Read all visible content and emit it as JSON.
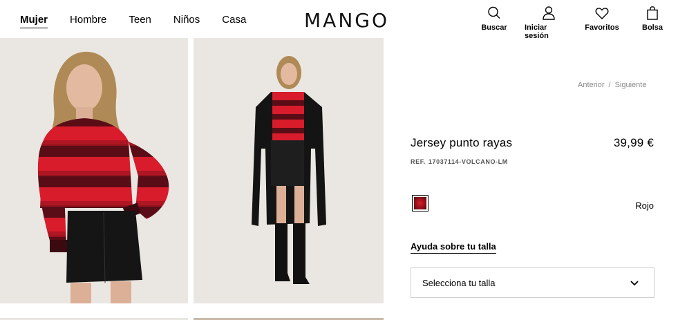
{
  "header": {
    "logo": "MANGO",
    "nav": [
      {
        "label": "Mujer",
        "active": true
      },
      {
        "label": "Hombre",
        "active": false
      },
      {
        "label": "Teen",
        "active": false
      },
      {
        "label": "Niños",
        "active": false
      },
      {
        "label": "Casa",
        "active": false
      }
    ],
    "actions": [
      {
        "label": "Buscar",
        "icon": "search-icon"
      },
      {
        "label": "Iniciar sesión",
        "icon": "user-icon"
      },
      {
        "label": "Favoritos",
        "icon": "heart-icon"
      },
      {
        "label": "Bolsa",
        "icon": "bag-icon"
      }
    ]
  },
  "product": {
    "pager": {
      "prev": "Anterior",
      "separator": "/",
      "next": "Siguiente"
    },
    "title": "Jersey punto rayas",
    "price": "39,99 €",
    "ref_label": "REF.",
    "ref_value": "17037114-VOLCANO-LM",
    "color": {
      "name": "Rojo",
      "swatch_hex": "#c8182a"
    },
    "size_help": "Ayuda sobre tu talla",
    "size_select_placeholder": "Selecciona tu talla"
  },
  "colors": {
    "photo_bg": "#eae7e2",
    "sweater_red": "#d81c2c",
    "sweater_dark": "#3a0a10",
    "leather_black": "#151515"
  }
}
